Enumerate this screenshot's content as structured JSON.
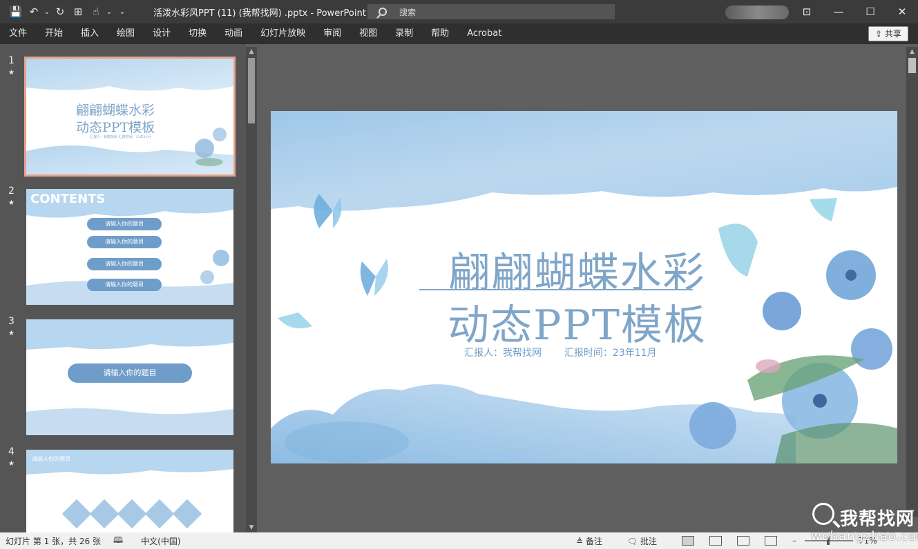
{
  "window": {
    "title": "活泼水彩风PPT (11) (我帮找网) .pptx  -  PowerPoint",
    "search_placeholder": "搜索",
    "min_label": "—",
    "max_label": "☐",
    "close_label": "✕",
    "ribbon_display_label": "⊡"
  },
  "quick_access": [
    "💾",
    "↶",
    "⌄",
    "↻",
    "⊞",
    "☝",
    "⌄",
    "⌄"
  ],
  "ribbon": {
    "tabs": [
      "文件",
      "开始",
      "插入",
      "绘图",
      "设计",
      "切换",
      "动画",
      "幻灯片放映",
      "审阅",
      "视图",
      "录制",
      "帮助",
      "Acrobat"
    ],
    "share_label": "共享"
  },
  "thumbnails": [
    {
      "num": "1",
      "star": "★",
      "title1": "翩翩蝴蝶水彩",
      "title2": "动态PPT模板",
      "small": "汇报人：我帮找网    汇报时间：23年11月"
    },
    {
      "num": "2",
      "star": "★",
      "heading": "CONTENTS",
      "items": [
        "请输入你的题目",
        "请输入你的题目",
        "请输入你的题目",
        "请输入你的题目"
      ]
    },
    {
      "num": "3",
      "star": "★",
      "banner": "请输入你的题目"
    },
    {
      "num": "4",
      "star": "★",
      "heading": "请输入你的题目"
    }
  ],
  "slide": {
    "title_line1": "翩翩蝴蝶水彩",
    "title_line2": "动态PPT模板",
    "reporter": "汇报人：我帮找网",
    "report_time": "汇报时间：23年11月"
  },
  "status": {
    "slide_info": "幻灯片 第 1 张，共 26 张",
    "language": "中文(中国)",
    "notes": "备注",
    "comments": "批注",
    "zoom": "71%"
  },
  "watermark": {
    "cn": "我帮找网",
    "en": "wobangzhao.com"
  },
  "colors": {
    "accent": "#7fa6c9",
    "selection": "#e8a28b"
  }
}
